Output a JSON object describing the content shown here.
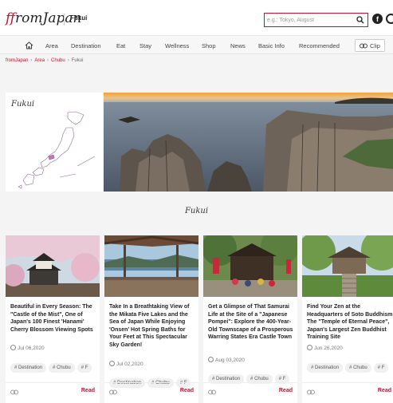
{
  "header": {
    "logo_text": "fromJapan",
    "region": "Fukui",
    "search_placeholder": "e.g.: Tokyo, August",
    "icons": {
      "search": "search-icon",
      "facebook": "facebook-icon",
      "web": "web-icon"
    }
  },
  "nav": {
    "items": [
      "Area",
      "Destination",
      "Eat",
      "Stay",
      "Wellness",
      "Shop",
      "News",
      "Basic Info",
      "Recommended"
    ],
    "clip_label": "Clip"
  },
  "breadcrumb": [
    "fromJapan",
    "Area",
    "Chubu",
    "Fukui"
  ],
  "hero": {
    "map_title": "Fukui"
  },
  "section_title": "Fukui",
  "cards": [
    {
      "title": "Beautiful in Every Season: The \"Castle of the Mist\", One of Japan's 100 Finest 'Hanami' Cherry Blossom Viewing Spots",
      "date": "Jul 06,2020",
      "tags": [
        "Destination",
        "Chubu",
        "F"
      ],
      "read": "Read"
    },
    {
      "title": "Take In a Breathtaking View of the Mikata Five Lakes and the Sea of Japan While Enjoying 'Onsen' Hot Spring Baths for Your Feet at This Spectacular Sky Garden!",
      "date": "Jul 02,2020",
      "tags": [
        "Destination",
        "Chubu",
        "F"
      ],
      "read": "Read"
    },
    {
      "title": "Get a Glimpse of That Samurai Life at the Site of a \"Japanese Pompei\": Explore the 400-Year-Old Townscape of a Prosperous Warring States Era Castle Town",
      "date": "Aug 03,2020",
      "tags": [
        "Destination",
        "Chubu",
        "F"
      ],
      "read": "Read"
    },
    {
      "title": "Find Your Zen at the Headquarters of Soto Buddhism: The \"Temple of Eternal Peace\", Japan's Largest Zen Buddhist Training Site",
      "date": "Jun 26,2020",
      "tags": [
        "Destination",
        "Chubu",
        "F"
      ],
      "read": "Read"
    }
  ],
  "colors": {
    "brand_red": "#c8102e"
  }
}
